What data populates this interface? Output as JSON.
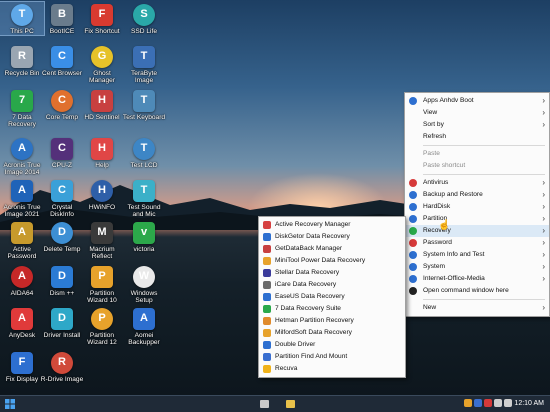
{
  "desktop_icons": [
    {
      "label": "This PC",
      "icon": "computer-icon",
      "color": "#5fa8e8",
      "selected": true
    },
    {
      "label": "BootICE",
      "icon": "bootice-icon",
      "color": "#6a7c8c"
    },
    {
      "label": "Fix Shortcut",
      "icon": "close-icon",
      "color": "#d83a30"
    },
    {
      "label": "SSD Life",
      "icon": "ssd-icon",
      "color": "#2aa8a8"
    },
    {
      "label": "Recycle Bin",
      "icon": "recycle-bin-icon",
      "color": "#9aa6b2"
    },
    {
      "label": "Cent Browser",
      "icon": "browser-icon",
      "color": "#3a8ee6"
    },
    {
      "label": "Ghost Manager",
      "icon": "ghost-icon",
      "color": "#e6c229"
    },
    {
      "label": "TeraByte Image",
      "icon": "terabyte-icon",
      "color": "#3b6fb5"
    },
    {
      "label": "7 Data Recovery",
      "icon": "recovery-icon",
      "color": "#29a84a"
    },
    {
      "label": "Core Temp",
      "icon": "thermometer-icon",
      "color": "#e0702e"
    },
    {
      "label": "HD Sentinel",
      "icon": "hdd-icon",
      "color": "#c84040"
    },
    {
      "label": "Test Keyboard",
      "icon": "keyboard-icon",
      "color": "#4e8ab8"
    },
    {
      "label": "Acronis True Image 2014",
      "icon": "acronis-icon",
      "color": "#2d73c4"
    },
    {
      "label": "CPU-Z",
      "icon": "cpu-icon",
      "color": "#54307a"
    },
    {
      "label": "Help",
      "icon": "help-icon",
      "color": "#e04646"
    },
    {
      "label": "Test LCD",
      "icon": "monitor-icon",
      "color": "#3d86c6"
    },
    {
      "label": "Acronis True Image 2021",
      "icon": "acronis-icon",
      "color": "#1f63b8"
    },
    {
      "label": "Crystal DiskInfo",
      "icon": "crystal-disk-icon",
      "color": "#3aa0d8"
    },
    {
      "label": "HWiNFO",
      "icon": "hwinfo-icon",
      "color": "#2e5fa8"
    },
    {
      "label": "Test Sound and Mic",
      "icon": "speaker-icon",
      "color": "#3bb0c8"
    },
    {
      "label": "Active Password",
      "icon": "key-icon",
      "color": "#c79a2c"
    },
    {
      "label": "Delete Temp",
      "icon": "trash-icon",
      "color": "#3d8fd4"
    },
    {
      "label": "Macrium Reflect",
      "icon": "macrium-icon",
      "color": "#3a3a3a"
    },
    {
      "label": "victoria",
      "icon": "victoria-icon",
      "color": "#2ca84a"
    },
    {
      "label": "AIDA64",
      "icon": "aida-icon",
      "color": "#c62828"
    },
    {
      "label": "Dism ++",
      "icon": "dism-icon",
      "color": "#2b7bd4"
    },
    {
      "label": "Partition Wizard 10",
      "icon": "partition-icon",
      "color": "#e7a22b"
    },
    {
      "label": "Windows Setup",
      "icon": "windows-icon",
      "color": "#e9e9e9"
    },
    {
      "label": "AnyDesk",
      "icon": "anydesk-icon",
      "color": "#e03a3a"
    },
    {
      "label": "Driver Install",
      "icon": "driver-icon",
      "color": "#2ea8c8"
    },
    {
      "label": "Partition Wizard 12",
      "icon": "partition-icon",
      "color": "#e7a22b"
    },
    {
      "label": "Aomei Backupper",
      "icon": "aomei-icon",
      "color": "#2d6fd0"
    },
    {
      "label": "Fix Display",
      "icon": "display-icon",
      "color": "#2d6fd0"
    },
    {
      "label": "R-Drive Image",
      "icon": "rdrive-icon",
      "color": "#d04a3a"
    }
  ],
  "context_menu": {
    "items": [
      {
        "label": "Apps Anhdv Boot",
        "icon": "apps-icon",
        "color": "#2d6fd0",
        "arrow": true
      },
      {
        "label": "View",
        "arrow": true
      },
      {
        "label": "Sort by",
        "arrow": true
      },
      {
        "label": "Refresh"
      },
      {
        "sep": true
      },
      {
        "label": "Paste",
        "disabled": true
      },
      {
        "label": "Paste shortcut",
        "disabled": true
      },
      {
        "sep": true
      },
      {
        "label": "Antivirus",
        "icon": "antivirus-icon",
        "color": "#d63a3a",
        "arrow": true
      },
      {
        "label": "Backup and Restore",
        "icon": "backup-icon",
        "color": "#2d6fd0",
        "arrow": true
      },
      {
        "label": "HardDisk",
        "icon": "harddisk-icon",
        "color": "#2d6fd0",
        "arrow": true
      },
      {
        "label": "Partition",
        "icon": "partition-icon",
        "color": "#2d6fd0",
        "arrow": true
      },
      {
        "label": "Recovery",
        "icon": "recovery-icon",
        "color": "#29a84a",
        "arrow": true,
        "hover": true
      },
      {
        "label": "Password",
        "icon": "password-icon",
        "color": "#d63a3a",
        "arrow": true
      },
      {
        "label": "System Info and Test",
        "icon": "system-info-icon",
        "color": "#2d6fd0",
        "arrow": true
      },
      {
        "label": "System",
        "icon": "system-icon",
        "color": "#2d6fd0",
        "arrow": true
      },
      {
        "label": "Internet-Office-Media",
        "icon": "internet-icon",
        "color": "#2d6fd0",
        "arrow": true
      },
      {
        "label": "Open command window here",
        "icon": "cmd-icon",
        "color": "#222222"
      },
      {
        "sep": true
      },
      {
        "label": "New",
        "arrow": true
      }
    ]
  },
  "submenu": {
    "items": [
      {
        "label": "Active Recovery Manager",
        "icon": "active-recovery-icon",
        "color": "#d64040"
      },
      {
        "label": "DiskGetor Data Recovery",
        "icon": "diskgetor-icon",
        "color": "#2d6fd0"
      },
      {
        "label": "GetDataBack Manager",
        "icon": "getdataback-icon",
        "color": "#c84040"
      },
      {
        "label": "MiniTool Power Data Recovery",
        "icon": "minitool-icon",
        "color": "#e7a22b"
      },
      {
        "label": "Stellar Data Recovery",
        "icon": "stellar-icon",
        "color": "#3a3a9a"
      },
      {
        "label": "iCare Data Recovery",
        "icon": "icare-icon",
        "color": "#6a6a6a"
      },
      {
        "label": "EaseUS Data Recovery",
        "icon": "easeus-icon",
        "color": "#2d6fd0"
      },
      {
        "label": "7 Data Recovery Suite",
        "icon": "seven-data-icon",
        "color": "#29a84a"
      },
      {
        "label": "Hetman Partition Recovery",
        "icon": "hetman-icon",
        "color": "#e08a2b"
      },
      {
        "label": "MilfordSoft Data Recovery",
        "icon": "milfordsoft-icon",
        "color": "#e7a22b"
      },
      {
        "label": "Double Driver",
        "icon": "double-driver-icon",
        "color": "#2d6fd0"
      },
      {
        "label": "Partition Find And Mount",
        "icon": "partition-find-icon",
        "color": "#3a6fd0"
      },
      {
        "label": "Recuva",
        "icon": "recuva-icon",
        "color": "#f0b21a"
      }
    ]
  },
  "taskbar": {
    "start_icon": "windows-start-icon",
    "pinned": [
      {
        "icon": "control-panel-icon",
        "color": "#c8c8c8"
      },
      {
        "icon": "folder-icon",
        "color": "#e8c14a"
      }
    ],
    "tray": [
      {
        "icon": "tray-app-icon",
        "color": "#e7a22b"
      },
      {
        "icon": "tray-media-icon",
        "color": "#3a6fd0"
      },
      {
        "icon": "tray-record-icon",
        "color": "#d63a3a"
      },
      {
        "icon": "tray-network-icon",
        "color": "#cfcfcf"
      },
      {
        "icon": "tray-volume-icon",
        "color": "#cfcfcf"
      }
    ],
    "clock": "12:10 AM"
  }
}
